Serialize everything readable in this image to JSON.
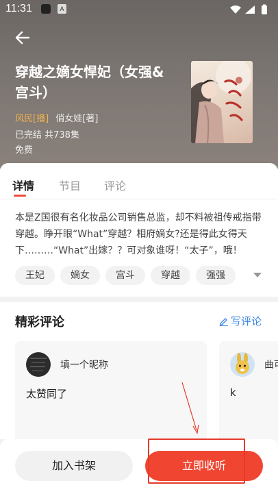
{
  "status_bar": {
    "time": "11:31",
    "indicator": "A"
  },
  "book": {
    "title": "穿越之嫡女悍妃（女强&宫斗）",
    "anchor": "风民[播]",
    "author": "俏女娃[著]",
    "status": "已完结  共738集",
    "price": "免费"
  },
  "tabs": [
    {
      "label": "详情",
      "active": true
    },
    {
      "label": "节目",
      "active": false
    },
    {
      "label": "评论",
      "active": false
    }
  ],
  "description": "本是Z国很有名化妆品公司销售总监，却不料被祖传戒指带穿越。睁开眼“What”穿越？相府嫡女?还是得此女得天下………“What”出嫁？？可对象谁呀！“太子”，哦！",
  "tags": [
    "王妃",
    "嫡女",
    "宫斗",
    "穿越",
    "强强"
  ],
  "comments_section": {
    "title": "精彩评论",
    "write_label": "写评论",
    "items": [
      {
        "user": "填一个昵称",
        "text": "太赞同了"
      },
      {
        "user": "曲可",
        "text": "k"
      }
    ]
  },
  "bottom_bar": {
    "add_shelf_label": "加入书架",
    "listen_label": "立即收听"
  },
  "colors": {
    "accent": "#f04530",
    "link": "#3c87e6",
    "anchor": "#f0b44d"
  }
}
